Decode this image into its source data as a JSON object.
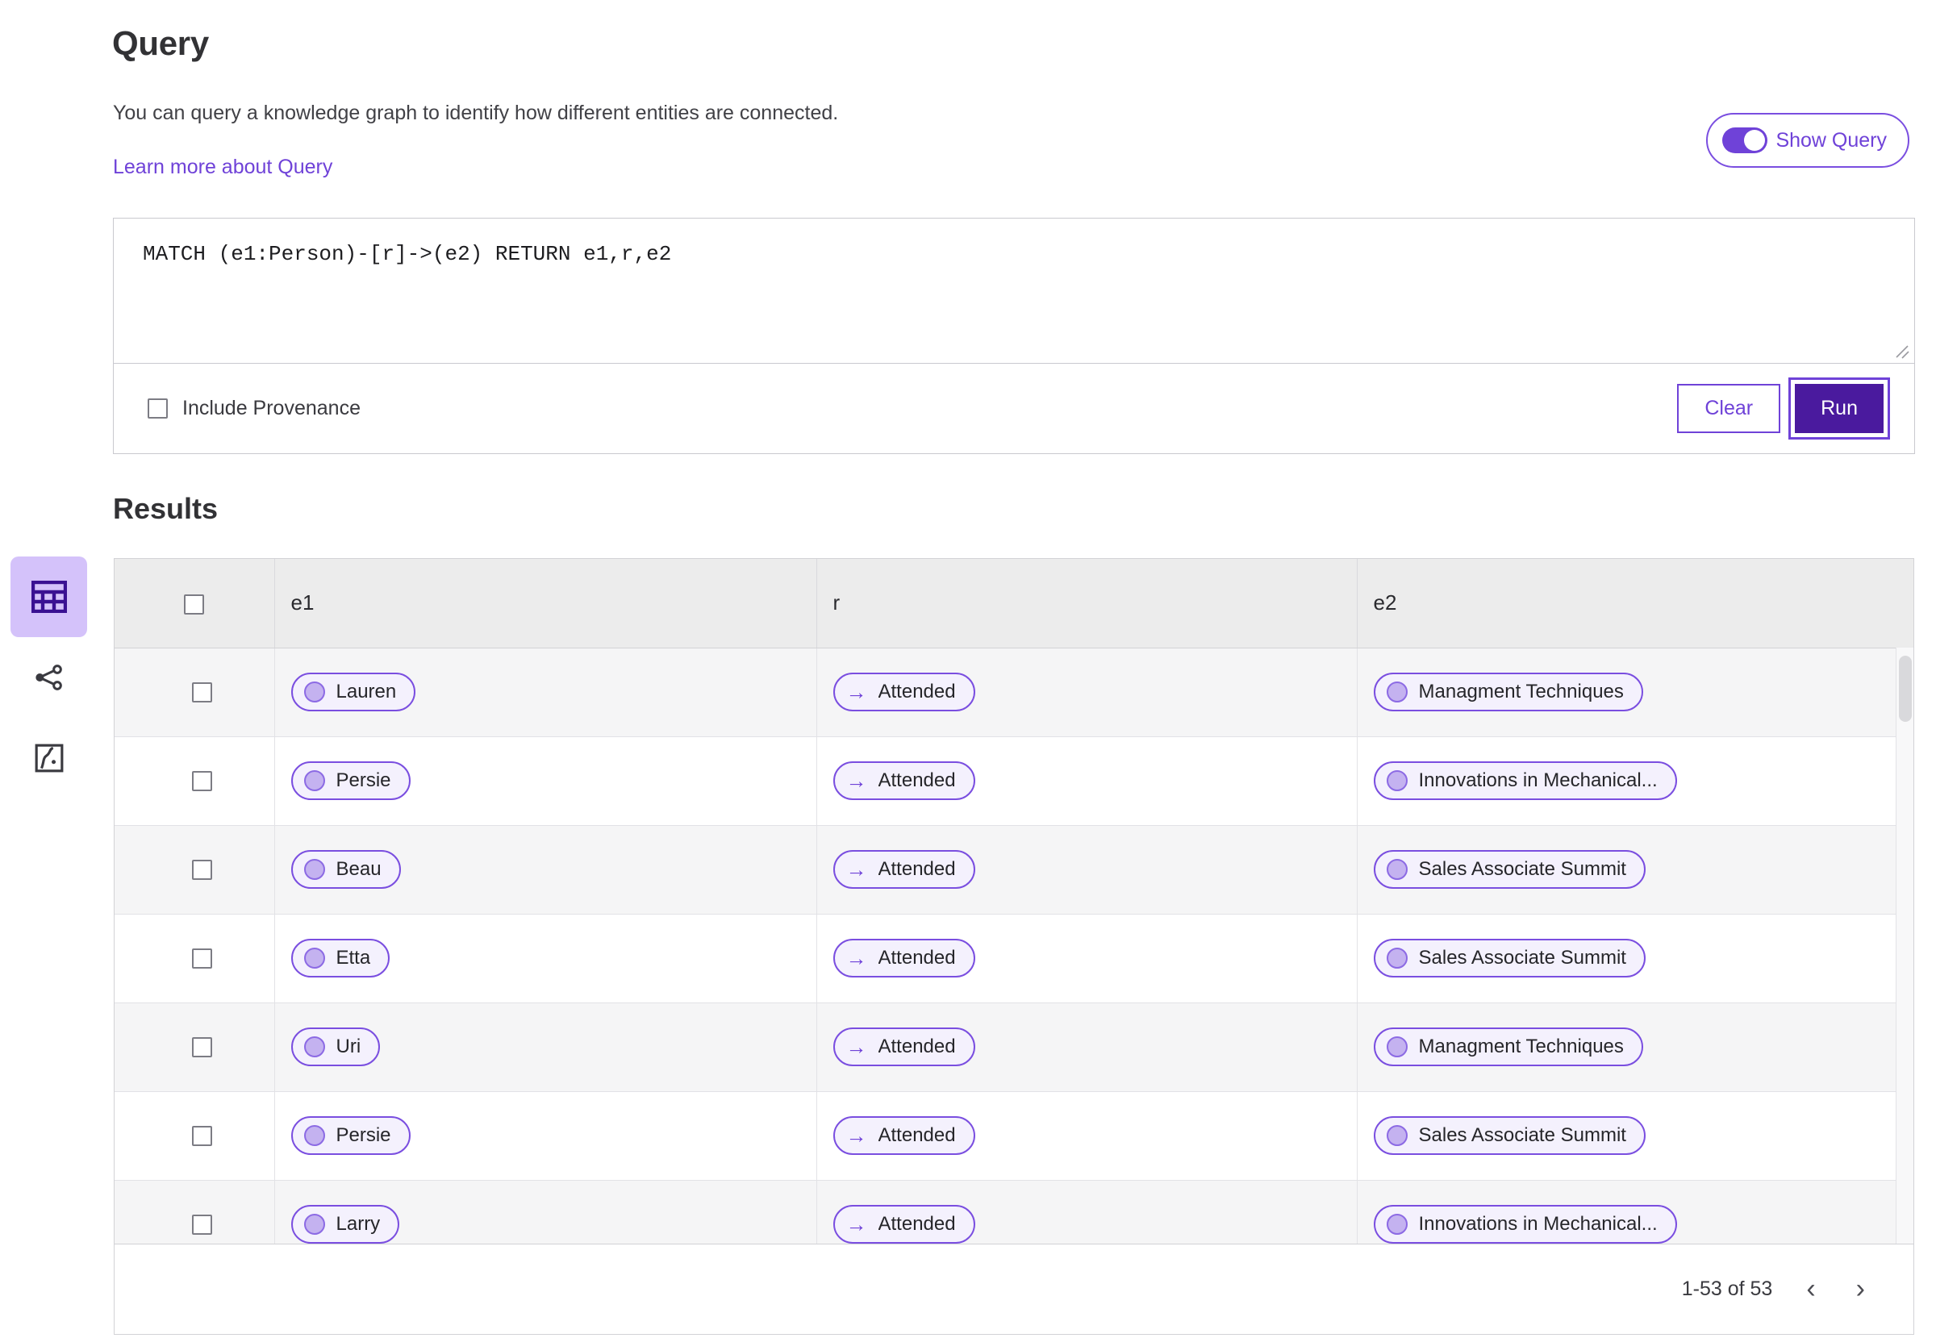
{
  "header": {
    "title": "Query",
    "description": "You can query a knowledge graph to identify how different entities are connected.",
    "learn_more_link": "Learn more about Query"
  },
  "show_query_toggle": {
    "label": "Show Query",
    "state": "on"
  },
  "query_editor": {
    "query_text": "MATCH (e1:Person)-[r]->(e2) RETURN e1,r,e2",
    "include_provenance_label": "Include Provenance",
    "include_provenance_checked": false,
    "clear_label": "Clear",
    "run_label": "Run"
  },
  "results": {
    "title": "Results",
    "columns": [
      "",
      "e1",
      "r",
      "e2"
    ],
    "rows": [
      {
        "e1": "Lauren",
        "r": "Attended",
        "e2": "Managment Techniques"
      },
      {
        "e1": "Persie",
        "r": "Attended",
        "e2": "Innovations in Mechanical..."
      },
      {
        "e1": "Beau",
        "r": "Attended",
        "e2": "Sales Associate Summit"
      },
      {
        "e1": "Etta",
        "r": "Attended",
        "e2": "Sales Associate Summit"
      },
      {
        "e1": "Uri",
        "r": "Attended",
        "e2": "Managment Techniques"
      },
      {
        "e1": "Persie",
        "r": "Attended",
        "e2": "Sales Associate Summit"
      },
      {
        "e1": "Larry",
        "r": "Attended",
        "e2": "Innovations in Mechanical..."
      }
    ],
    "pagination": {
      "range": "1-53 of 53",
      "prev": "‹",
      "next": "›"
    }
  },
  "sidebar": {
    "items": [
      {
        "icon": "table-view-icon",
        "active": true
      },
      {
        "icon": "graph-view-icon",
        "active": false
      },
      {
        "icon": "map-view-icon",
        "active": false
      }
    ]
  },
  "colors": {
    "accent_purple": "#6f42d8",
    "run_button": "#4a1a9e",
    "chip_border": "#7a4ee0",
    "chip_fill": "#f4f1fd",
    "rail_active": "#d4c2fa"
  }
}
